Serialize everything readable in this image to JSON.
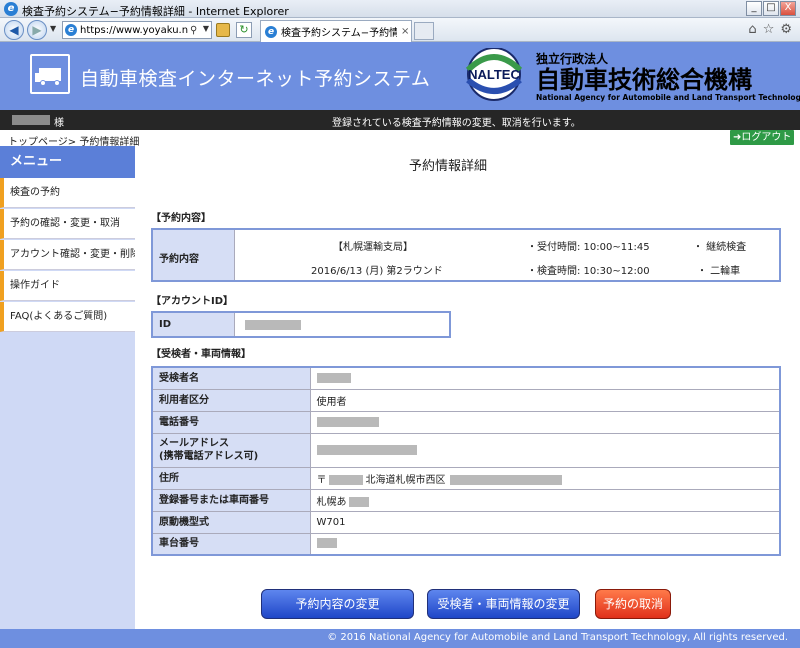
{
  "window": {
    "title": "検査予約システム−予約情報詳細 - Internet Explorer",
    "minimize": "_",
    "maximize": "□",
    "close": "X"
  },
  "browser": {
    "url": "https://www.yoyaku.nalte...",
    "tab_label": "検査予約システム−予約情報...",
    "tab_close": "×",
    "icons": [
      "back-arrow-icon",
      "forward-arrow-icon",
      "search-icon",
      "lock-icon",
      "refresh-icon",
      "home-icon",
      "favorites-star-icon",
      "gear-icon"
    ]
  },
  "header": {
    "system_title": "自動車検査インターネット予約システム",
    "org_logo_text": "NALTEC",
    "org_type": "独立行政法人",
    "org_name": "自動車技術総合機構",
    "org_name_en": "National Agency for Automobile and Land Transport Technology"
  },
  "user_bar": {
    "user_suffix": "様",
    "message": "登録されている検査予約情報の変更、取消を行います。"
  },
  "breadcrumb": "トップページ> 予約情報詳細",
  "logout_label": "ログアウト",
  "sidebar": {
    "header": "メニュー",
    "items": [
      {
        "label": "検査の予約"
      },
      {
        "label": "予約の確認・変更・取消"
      },
      {
        "label": "アカウント確認・変更・削除"
      },
      {
        "label": "操作ガイド"
      },
      {
        "label": "FAQ(よくあるご質問)"
      }
    ]
  },
  "main": {
    "title": "予約情報詳細",
    "reservation": {
      "section_label": "【予約内容】",
      "row_label": "予約内容",
      "office": "【札幌運輸支局】",
      "date_round": "2016/6/13 (月) 第2ラウンド",
      "reception_time": "・受付時間: 10:00~11:45",
      "inspection_time": "・検査時間: 10:30~12:00",
      "inspection_type": "・ 継続検査",
      "vehicle_type": "・ 二輪車"
    },
    "account": {
      "section_label": "【アカウントID】",
      "id_label": "ID"
    },
    "examinee": {
      "section_label": "【受検者・車両情報】",
      "rows": [
        {
          "label": "受検者名",
          "value": ""
        },
        {
          "label": "利用者区分",
          "value": "使用者"
        },
        {
          "label": "電話番号",
          "value": ""
        },
        {
          "label": "メールアドレス\n(携帯電話アドレス可)",
          "value": ""
        },
        {
          "label": "住所",
          "value": "〒",
          "value2": "北海道札幌市西区"
        },
        {
          "label": "登録番号または車両番号",
          "value": "札幌あ"
        },
        {
          "label": "原動機型式",
          "value": "W701"
        },
        {
          "label": "車台番号",
          "value": ""
        }
      ]
    }
  },
  "buttons": {
    "change_reservation": "予約内容の変更",
    "change_vehicle": "受検者・車両情報の変更",
    "cancel": "予約の取消"
  },
  "footer": "© 2016 National Agency for Automobile and Land Transport Technology, All rights reserved."
}
